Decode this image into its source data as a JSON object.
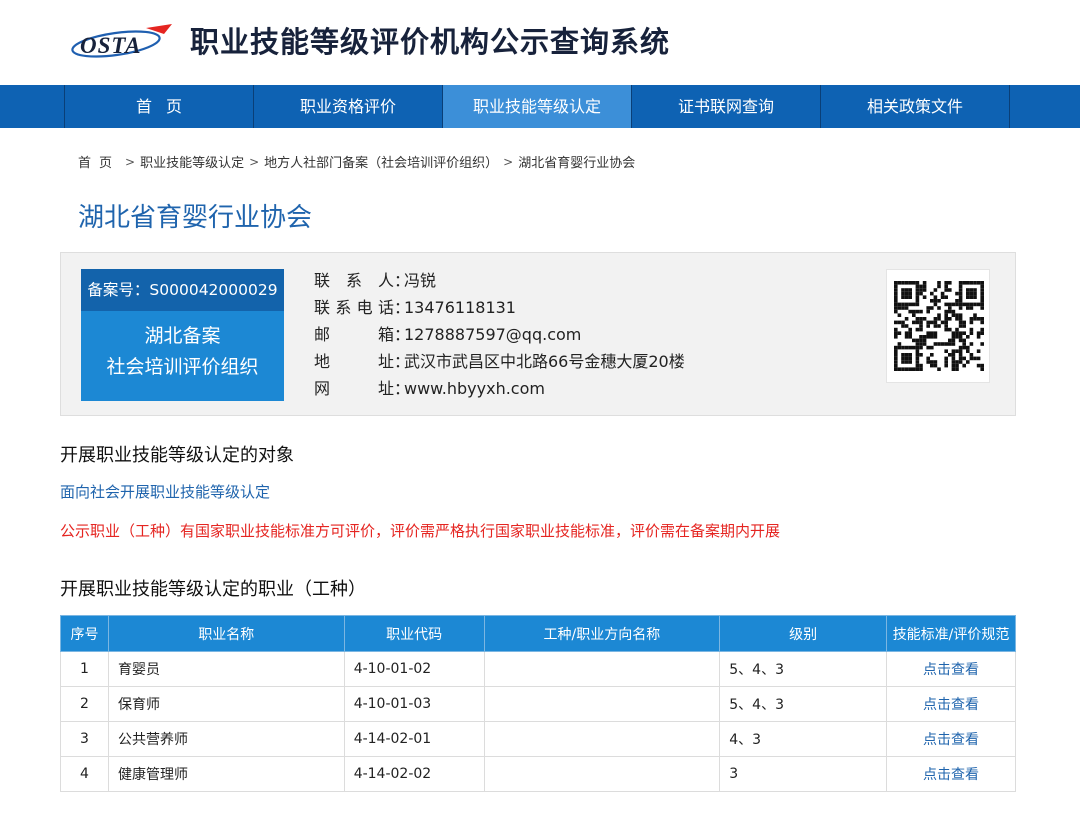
{
  "header": {
    "logo_text": "OSTA",
    "title": "职业技能等级评价机构公示查询系统"
  },
  "nav": {
    "items": [
      {
        "label": "首页"
      },
      {
        "label": "职业资格评价"
      },
      {
        "label": "职业技能等级认定"
      },
      {
        "label": "证书联网查询"
      },
      {
        "label": "相关政策文件"
      }
    ],
    "active_index": 2
  },
  "breadcrumb": {
    "items": [
      "首页",
      "职业技能等级认定",
      "地方人社部门备案（社会培训评价组织）",
      "湖北省育婴行业协会"
    ],
    "separator": ">"
  },
  "org": {
    "name": "湖北省育婴行业协会",
    "record_no": "备案号：S000042000029",
    "badge_line1": "湖北备案",
    "badge_line2": "社会培训评价组织",
    "contact_label": "联系人",
    "contact": "冯锐",
    "phone_label": "联系电话",
    "phone": "13476118131",
    "email_label": "邮箱",
    "email": "1278887597@qq.com",
    "address_label": "地址",
    "address": "武汉市武昌区中北路66号金穗大厦20楼",
    "website_label": "网址",
    "website": "www.hbyyxh.com"
  },
  "sections": {
    "target_heading": "开展职业技能等级认定的对象",
    "target_text": "面向社会开展职业技能等级认定",
    "notice": "公示职业（工种）有国家职业技能标准方可评价，评价需严格执行国家职业技能标准，评价需在备案期内开展",
    "occupations_heading": "开展职业技能等级认定的职业（工种）"
  },
  "table": {
    "headers": [
      "序号",
      "职业名称",
      "职业代码",
      "工种/职业方向名称",
      "级别",
      "技能标准/评价规范"
    ],
    "rows": [
      {
        "no": "1",
        "name": "育婴员",
        "code": "4-10-01-02",
        "direction": "",
        "level": "5、4、3",
        "link": "点击查看"
      },
      {
        "no": "2",
        "name": "保育师",
        "code": "4-10-01-03",
        "direction": "",
        "level": "5、4、3",
        "link": "点击查看"
      },
      {
        "no": "3",
        "name": "公共营养师",
        "code": "4-14-02-01",
        "direction": "",
        "level": "4、3",
        "link": "点击查看"
      },
      {
        "no": "4",
        "name": "健康管理师",
        "code": "4-14-02-02",
        "direction": "",
        "level": "3",
        "link": "点击查看"
      }
    ]
  },
  "colors": {
    "nav_bg": "#0e62b3",
    "nav_active": "#3c8fd8",
    "accent_blue": "#1f64ad",
    "table_header": "#1c88d4",
    "notice_red": "#e52521"
  }
}
